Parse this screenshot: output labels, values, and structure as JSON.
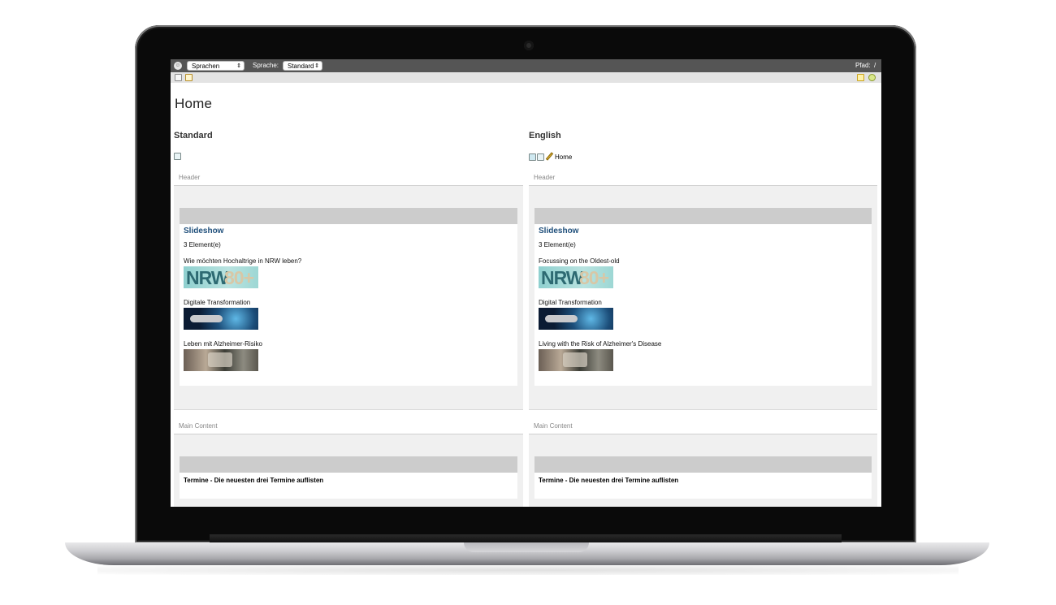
{
  "topbar": {
    "logo_icon": "circle-logo-icon",
    "language_select": "Sprachen",
    "sprache_label": "Sprache:",
    "sprache_value": "Standard",
    "pfad_label": "Pfad:",
    "pfad_value": "/"
  },
  "toolbar": {
    "left_icons": [
      "page-icon",
      "edit-icon"
    ],
    "right_icons": [
      "note-icon",
      "add-icon"
    ]
  },
  "page": {
    "title": "Home"
  },
  "columns": [
    {
      "title": "Standard",
      "home_link": "",
      "header_label": "Header",
      "slideshow_title": "Slideshow",
      "slideshow_count": "3 Element(e)",
      "items": [
        {
          "label": "Wie möchten Hochaltrige in NRW leben?",
          "thumb": "NRW 80+"
        },
        {
          "label": "Digitale Transformation",
          "thumb": ""
        },
        {
          "label": "Leben mit Alzheimer-Risiko",
          "thumb": ""
        }
      ],
      "main_label": "Main Content",
      "main_text": "Termine - Die neuesten drei Termine auflisten"
    },
    {
      "title": "English",
      "home_link": "Home",
      "header_label": "Header",
      "slideshow_title": "Slideshow",
      "slideshow_count": "3 Element(e)",
      "items": [
        {
          "label": "Focussing on the Oldest-old",
          "thumb": "NRW 80+"
        },
        {
          "label": "Digital Transformation",
          "thumb": ""
        },
        {
          "label": "Living with the Risk of Alzheimer's Disease",
          "thumb": ""
        }
      ],
      "main_label": "Main Content",
      "main_text": "Termine - Die neuesten drei Termine auflisten"
    }
  ],
  "colors": {
    "topbar": "#555555",
    "toolbar": "#e3e3e3",
    "card_header": "#cccccc",
    "slideshow_title": "#1e4e7a"
  }
}
